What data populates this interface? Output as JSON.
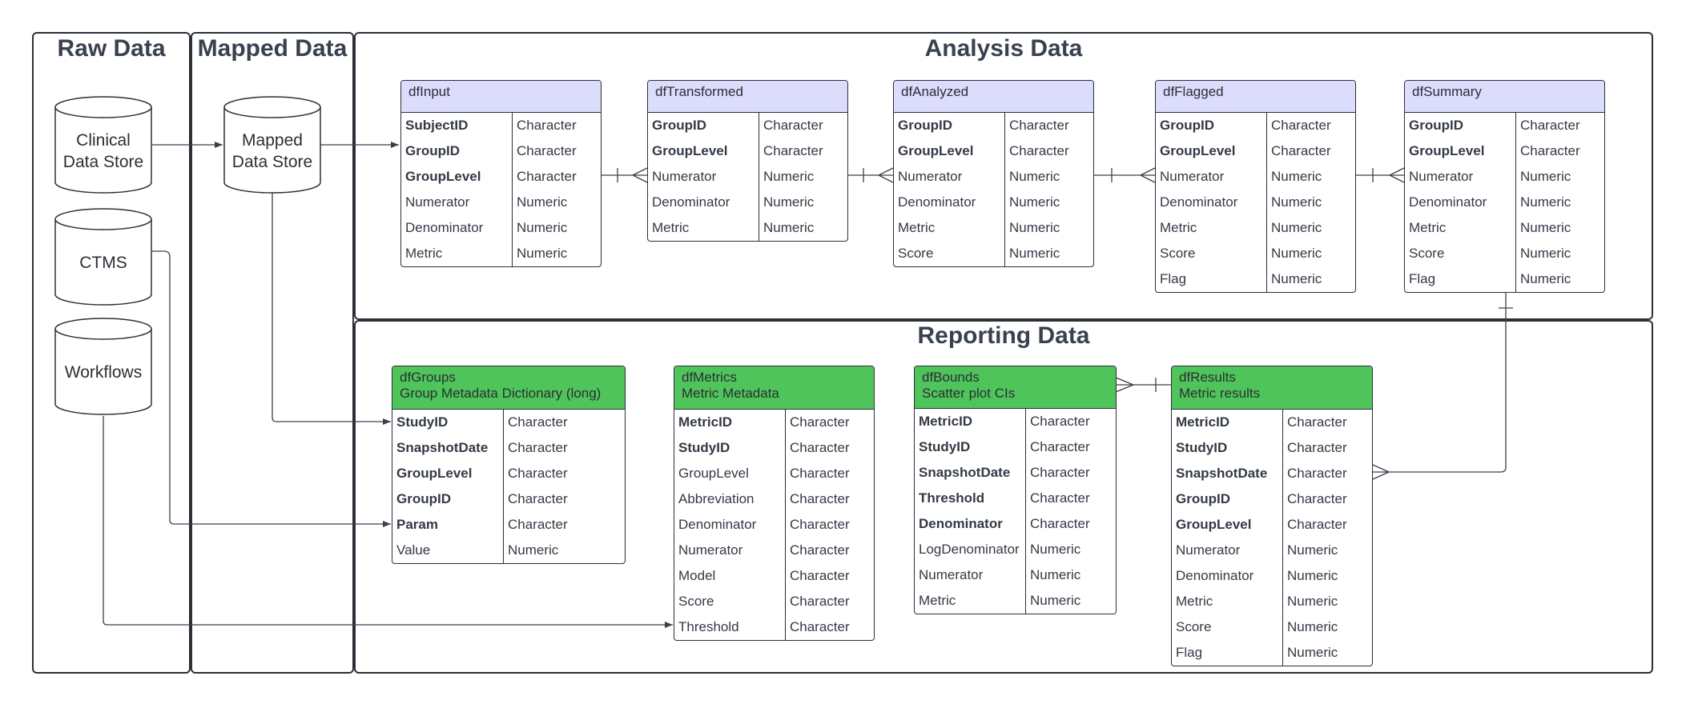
{
  "panels": {
    "raw": "Raw Data",
    "mapped": "Mapped Data",
    "analysis": "Analysis Data",
    "reporting": "Reporting Data"
  },
  "stores": {
    "clinical": [
      "Clinical",
      "Data Store"
    ],
    "ctms": [
      "CTMS"
    ],
    "workflows": [
      "Workflows"
    ],
    "mapped": [
      "Mapped",
      "Data Store"
    ]
  },
  "tables": {
    "dfInput": {
      "title": "dfInput",
      "subtitle": "",
      "color": "#dcdcfc",
      "fields": [
        {
          "name": "SubjectID",
          "type": "Character",
          "key": true
        },
        {
          "name": "GroupID",
          "type": "Character",
          "key": true
        },
        {
          "name": "GroupLevel",
          "type": "Character",
          "key": true
        },
        {
          "name": "Numerator",
          "type": "Numeric",
          "key": false
        },
        {
          "name": "Denominator",
          "type": "Numeric",
          "key": false
        },
        {
          "name": "Metric",
          "type": "Numeric",
          "key": false
        }
      ]
    },
    "dfTransformed": {
      "title": "dfTransformed",
      "subtitle": "",
      "color": "#dcdcfc",
      "fields": [
        {
          "name": "GroupID",
          "type": "Character",
          "key": true
        },
        {
          "name": "GroupLevel",
          "type": "Character",
          "key": true
        },
        {
          "name": "Numerator",
          "type": "Numeric",
          "key": false
        },
        {
          "name": "Denominator",
          "type": "Numeric",
          "key": false
        },
        {
          "name": "Metric",
          "type": "Numeric",
          "key": false
        }
      ]
    },
    "dfAnalyzed": {
      "title": "dfAnalyzed",
      "subtitle": "",
      "color": "#dcdcfc",
      "fields": [
        {
          "name": "GroupID",
          "type": "Character",
          "key": true
        },
        {
          "name": "GroupLevel",
          "type": "Character",
          "key": true
        },
        {
          "name": "Numerator",
          "type": "Numeric",
          "key": false
        },
        {
          "name": "Denominator",
          "type": "Numeric",
          "key": false
        },
        {
          "name": "Metric",
          "type": "Numeric",
          "key": false
        },
        {
          "name": "Score",
          "type": "Numeric",
          "key": false
        }
      ]
    },
    "dfFlagged": {
      "title": "dfFlagged",
      "subtitle": "",
      "color": "#dcdcfc",
      "fields": [
        {
          "name": "GroupID",
          "type": "Character",
          "key": true
        },
        {
          "name": "GroupLevel",
          "type": "Character",
          "key": true
        },
        {
          "name": "Numerator",
          "type": "Numeric",
          "key": false
        },
        {
          "name": "Denominator",
          "type": "Numeric",
          "key": false
        },
        {
          "name": "Metric",
          "type": "Numeric",
          "key": false
        },
        {
          "name": "Score",
          "type": "Numeric",
          "key": false
        },
        {
          "name": "Flag",
          "type": "Numeric",
          "key": false
        }
      ]
    },
    "dfSummary": {
      "title": "dfSummary",
      "subtitle": "",
      "color": "#dcdcfc",
      "fields": [
        {
          "name": "GroupID",
          "type": "Character",
          "key": true
        },
        {
          "name": "GroupLevel",
          "type": "Character",
          "key": true
        },
        {
          "name": "Numerator",
          "type": "Numeric",
          "key": false
        },
        {
          "name": "Denominator",
          "type": "Numeric",
          "key": false
        },
        {
          "name": "Metric",
          "type": "Numeric",
          "key": false
        },
        {
          "name": "Score",
          "type": "Numeric",
          "key": false
        },
        {
          "name": "Flag",
          "type": "Numeric",
          "key": false
        }
      ]
    },
    "dfGroups": {
      "title": "dfGroups",
      "subtitle": "Group Metadata Dictionary (long)",
      "color": "#4fc45a",
      "fields": [
        {
          "name": "StudyID",
          "type": "Character",
          "key": true
        },
        {
          "name": "SnapshotDate",
          "type": "Character",
          "key": true
        },
        {
          "name": "GroupLevel",
          "type": "Character",
          "key": true
        },
        {
          "name": "GroupID",
          "type": "Character",
          "key": true
        },
        {
          "name": "Param",
          "type": "Character",
          "key": true
        },
        {
          "name": "Value",
          "type": "Numeric",
          "key": false
        }
      ]
    },
    "dfMetrics": {
      "title": "dfMetrics",
      "subtitle": "Metric Metadata",
      "color": "#4fc45a",
      "fields": [
        {
          "name": "MetricID",
          "type": "Character",
          "key": true
        },
        {
          "name": "StudyID",
          "type": "Character",
          "key": true
        },
        {
          "name": "GroupLevel",
          "type": "Character",
          "key": false
        },
        {
          "name": "Abbreviation",
          "type": "Character",
          "key": false
        },
        {
          "name": "Denominator",
          "type": "Character",
          "key": false
        },
        {
          "name": "Numerator",
          "type": "Character",
          "key": false
        },
        {
          "name": "Model",
          "type": "Character",
          "key": false
        },
        {
          "name": "Score",
          "type": "Character",
          "key": false
        },
        {
          "name": "Threshold",
          "type": "Character",
          "key": false
        }
      ]
    },
    "dfBounds": {
      "title": "dfBounds",
      "subtitle": "Scatter plot CIs",
      "color": "#4fc45a",
      "fields": [
        {
          "name": "MetricID",
          "type": "Character",
          "key": true
        },
        {
          "name": "StudyID",
          "type": "Character",
          "key": true
        },
        {
          "name": "SnapshotDate",
          "type": "Character",
          "key": true
        },
        {
          "name": "Threshold",
          "type": "Character",
          "key": true
        },
        {
          "name": "Denominator",
          "type": "Character",
          "key": true
        },
        {
          "name": "LogDenominator",
          "type": "Numeric",
          "key": false
        },
        {
          "name": "Numerator",
          "type": "Numeric",
          "key": false
        },
        {
          "name": "Metric",
          "type": "Numeric",
          "key": false
        }
      ]
    },
    "dfResults": {
      "title": "dfResults",
      "subtitle": "Metric results",
      "color": "#4fc45a",
      "fields": [
        {
          "name": "MetricID",
          "type": "Character",
          "key": true
        },
        {
          "name": "StudyID",
          "type": "Character",
          "key": true
        },
        {
          "name": "SnapshotDate",
          "type": "Character",
          "key": true
        },
        {
          "name": "GroupID",
          "type": "Character",
          "key": true
        },
        {
          "name": "GroupLevel",
          "type": "Character",
          "key": true
        },
        {
          "name": "Numerator",
          "type": "Numeric",
          "key": false
        },
        {
          "name": "Denominator",
          "type": "Numeric",
          "key": false
        },
        {
          "name": "Metric",
          "type": "Numeric",
          "key": false
        },
        {
          "name": "Score",
          "type": "Numeric",
          "key": false
        },
        {
          "name": "Flag",
          "type": "Numeric",
          "key": false
        }
      ]
    }
  }
}
